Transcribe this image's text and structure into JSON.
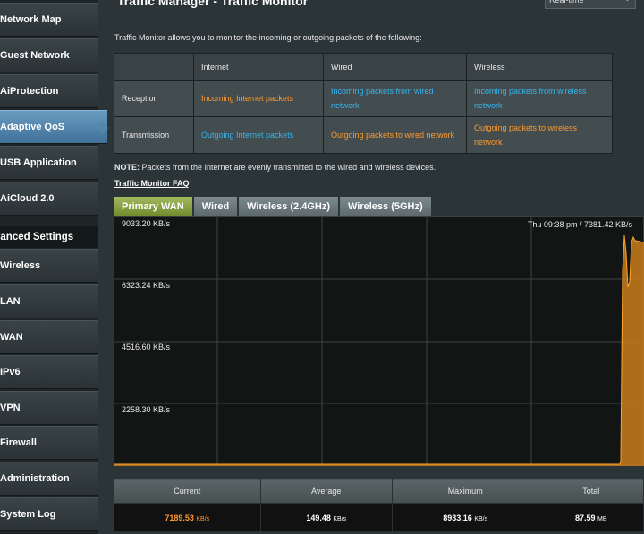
{
  "sidebar": {
    "items_top": [
      {
        "label": "Network Map",
        "icon": "network-map-icon"
      },
      {
        "label": "Guest Network",
        "icon": "guest-network-icon"
      },
      {
        "label": "AiProtection",
        "icon": "aiprotection-icon"
      },
      {
        "label": "Adaptive QoS",
        "icon": "adaptive-qos-icon",
        "active": true
      },
      {
        "label": "USB Application",
        "icon": "usb-icon"
      },
      {
        "label": "AiCloud 2.0",
        "icon": "aicloud-icon"
      }
    ],
    "header": "vanced Settings",
    "items_advanced": [
      {
        "label": "Wireless"
      },
      {
        "label": "LAN"
      },
      {
        "label": "WAN"
      },
      {
        "label": "IPv6"
      },
      {
        "label": "VPN"
      },
      {
        "label": "Firewall"
      },
      {
        "label": "Administration"
      },
      {
        "label": "System Log"
      }
    ]
  },
  "page": {
    "title": "Traffic Manager - Traffic Monitor",
    "language_select": "Real-time",
    "intro": "Traffic Monitor allows you to monitor the incoming or outgoing packets of the following:",
    "table": {
      "headers": [
        "",
        "Internet",
        "Wired",
        "Wireless"
      ],
      "rows": [
        {
          "label": "Reception",
          "cells": [
            "Incoming Internet packets",
            "Incoming packets from wired network",
            "Incoming packets from wireless network"
          ]
        },
        {
          "label": "Transmission",
          "cells": [
            "Outgoing Internet packets",
            "Outgoing packets to wired network",
            "Outgoing packets to wireless network"
          ]
        }
      ]
    },
    "note_label": "NOTE:",
    "note_text": " Packets from the Internet are evenly transmitted to the wired and wireless devices.",
    "faq_link": "Traffic Monitor FAQ",
    "tabs": [
      "Primary WAN",
      "Wired",
      "Wireless (2.4GHz)",
      "Wireless (5GHz)"
    ],
    "active_tab": "Primary WAN"
  },
  "graph": {
    "y_labels": [
      "9033.20 KB/s",
      "6323.24 KB/s",
      "4516.60 KB/s",
      "2258.30 KB/s"
    ],
    "time_readout": "Thu 09:38 pm / 7381.42 KB/s",
    "colors": {
      "area": "#c97c1a",
      "stroke": "#ffa42a",
      "grid": "#3c4244",
      "background": "#131515"
    }
  },
  "stats": {
    "headers": [
      "Current",
      "Average",
      "Maximum",
      "Total"
    ],
    "values": [
      {
        "value": "7189.53",
        "unit": "KB/s"
      },
      {
        "value": "149.48",
        "unit": "KB/s"
      },
      {
        "value": "8933.16",
        "unit": "KB/s"
      },
      {
        "value": "87.59",
        "unit": "MB"
      }
    ]
  }
}
